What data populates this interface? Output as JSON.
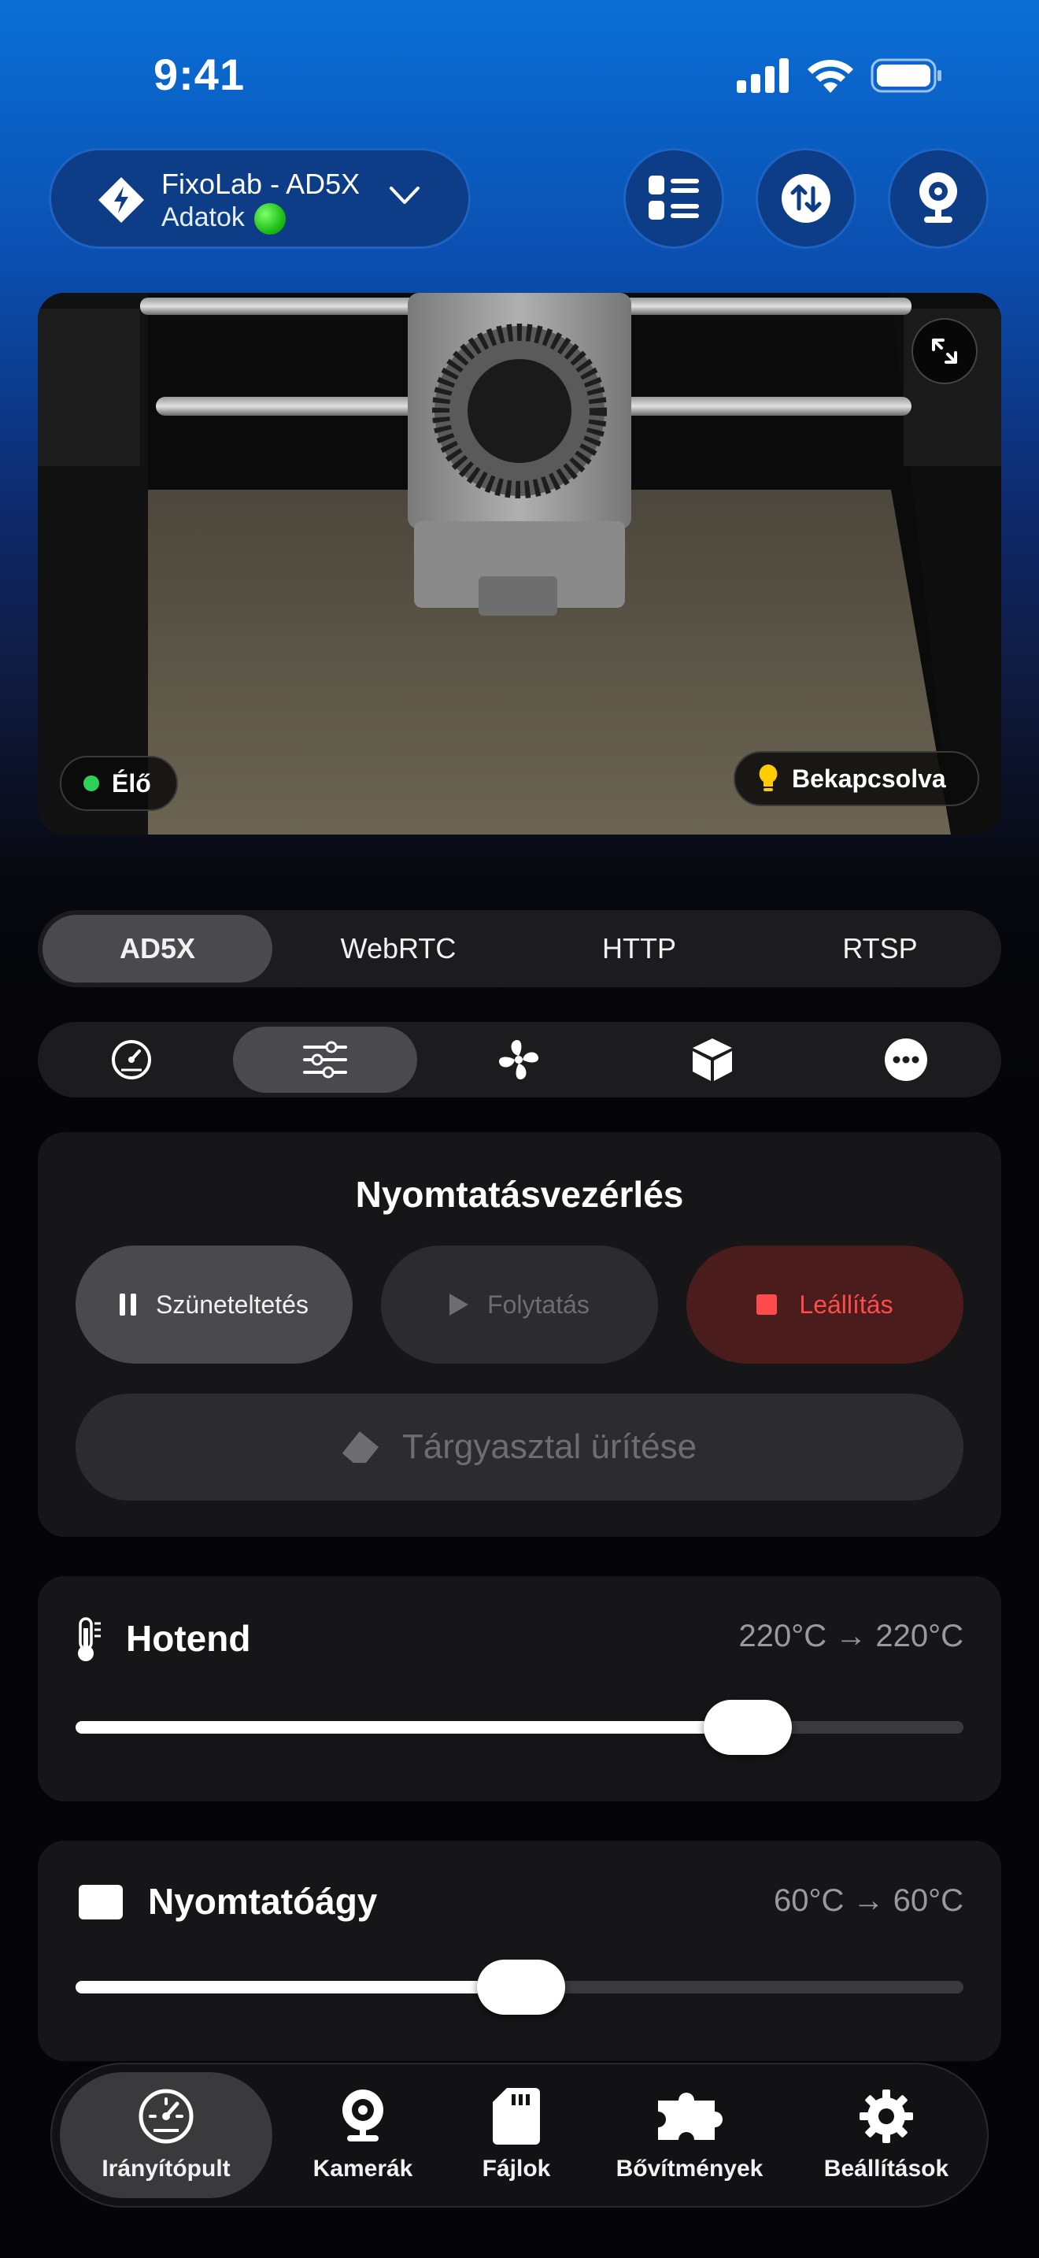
{
  "status_bar": {
    "time": "9:41"
  },
  "header": {
    "printer_name": "FixoLab - AD5X",
    "printer_subtitle": "Adatok",
    "buttons": [
      "list-icon",
      "transfer-icon",
      "webcam-icon"
    ]
  },
  "camera": {
    "live_label": "Élő",
    "light_label": "Bekapcsolva",
    "expand_icon": "expand-icon"
  },
  "stream_tabs": [
    {
      "label": "AD5X",
      "active": true
    },
    {
      "label": "WebRTC",
      "active": false
    },
    {
      "label": "HTTP",
      "active": false
    },
    {
      "label": "RTSP",
      "active": false
    }
  ],
  "panel_tabs": [
    {
      "icon": "gauge-icon",
      "active": false
    },
    {
      "icon": "sliders-icon",
      "active": true
    },
    {
      "icon": "fan-icon",
      "active": false
    },
    {
      "icon": "box-icon",
      "active": false
    },
    {
      "icon": "more-icon",
      "active": false
    }
  ],
  "print_control": {
    "title": "Nyomtatásvezérlés",
    "pause_label": "Szüneteltetés",
    "resume_label": "Folytatás",
    "stop_label": "Leállítás",
    "clear_bed_label": "Tárgyasztal ürítése",
    "stop_color": "#ff4b4b"
  },
  "hotend": {
    "title": "Hotend",
    "temp_text": "220°C → 220°C",
    "level_percent": 80
  },
  "bed": {
    "title": "Nyomtatóágy",
    "temp_text": "60°C → 60°C",
    "level_percent": 50
  },
  "tab_bar": [
    {
      "label": "Irányítópult",
      "icon": "dashboard-icon",
      "active": true
    },
    {
      "label": "Kamerák",
      "icon": "webcam-icon",
      "active": false
    },
    {
      "label": "Fájlok",
      "icon": "sdcard-icon",
      "active": false
    },
    {
      "label": "Bővítmények",
      "icon": "puzzle-icon",
      "active": false
    },
    {
      "label": "Beállítások",
      "icon": "gear-icon",
      "active": false
    }
  ]
}
